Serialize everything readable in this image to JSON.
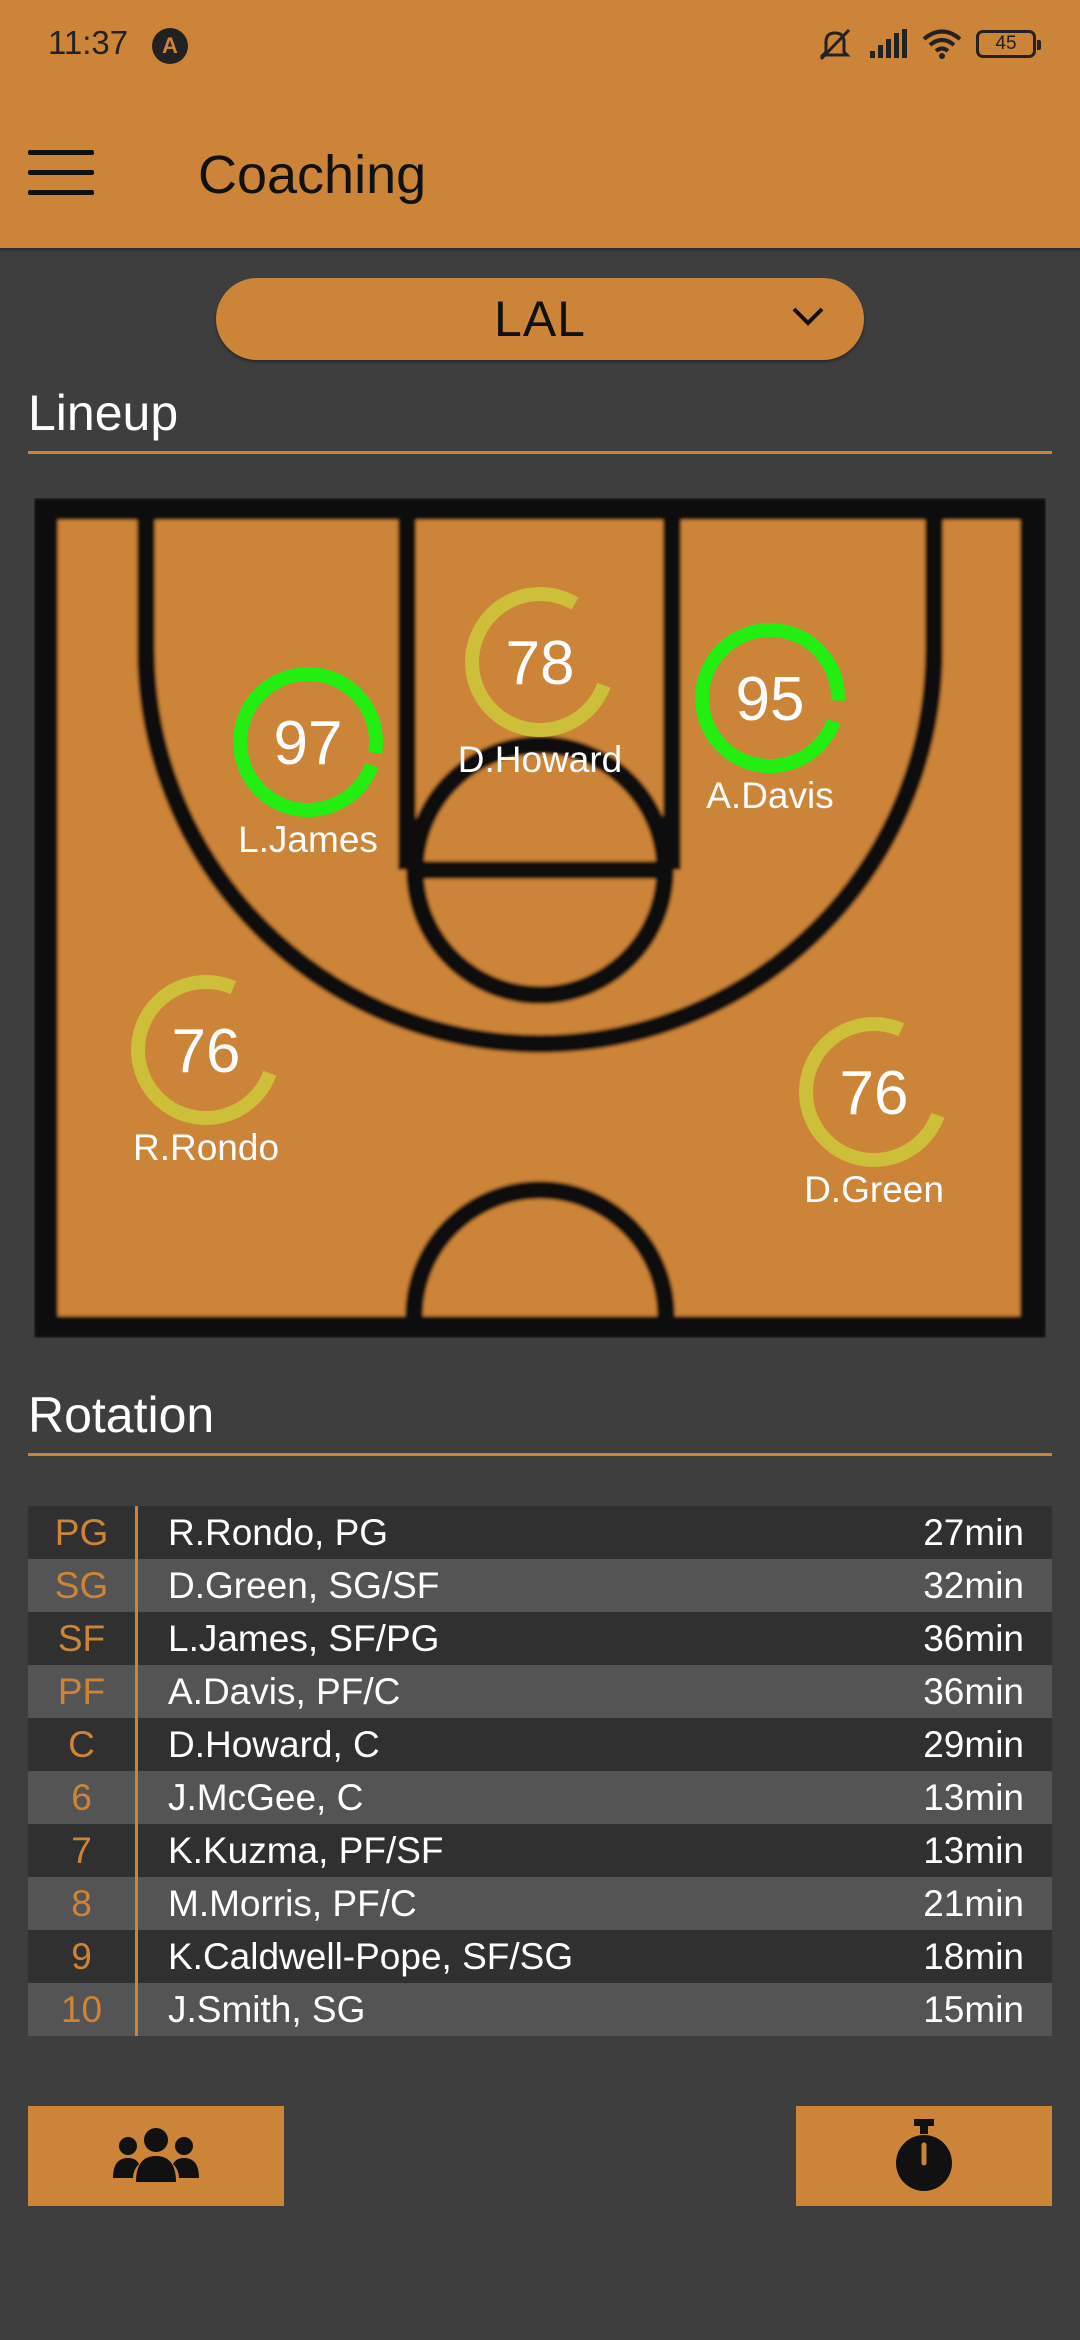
{
  "status_bar": {
    "time": "11:37",
    "app_icon_letter": "A",
    "battery": "45",
    "icons": [
      "mute-icon",
      "signal-icon",
      "wifi-icon",
      "battery-icon"
    ]
  },
  "app_bar": {
    "title": "Coaching",
    "menu_icon": "hamburger-menu-icon"
  },
  "team_selector": {
    "value": "LAL",
    "icon": "chevron-down-icon"
  },
  "lineup": {
    "title": "Lineup",
    "players": [
      {
        "name": "L.James",
        "rating": "97",
        "level": 97,
        "color": "#22ee11"
      },
      {
        "name": "D.Howard",
        "rating": "78",
        "level": 78,
        "color": "#cdbf3a"
      },
      {
        "name": "A.Davis",
        "rating": "95",
        "level": 95,
        "color": "#22ee11"
      },
      {
        "name": "R.Rondo",
        "rating": "76",
        "level": 76,
        "color": "#cdbf3a"
      },
      {
        "name": "D.Green",
        "rating": "76",
        "level": 76,
        "color": "#cdbf3a"
      }
    ]
  },
  "rotation": {
    "title": "Rotation",
    "rows": [
      {
        "slot": "PG",
        "player": "R.Rondo, PG",
        "minutes": "27min"
      },
      {
        "slot": "SG",
        "player": "D.Green, SG/SF",
        "minutes": "32min"
      },
      {
        "slot": "SF",
        "player": "L.James, SF/PG",
        "minutes": "36min"
      },
      {
        "slot": "PF",
        "player": "A.Davis, PF/C",
        "minutes": "36min"
      },
      {
        "slot": "C",
        "player": "D.Howard, C",
        "minutes": "29min"
      },
      {
        "slot": "6",
        "player": "J.McGee, C",
        "minutes": "13min"
      },
      {
        "slot": "7",
        "player": "K.Kuzma, PF/SF",
        "minutes": "13min"
      },
      {
        "slot": "8",
        "player": "M.Morris, PF/C",
        "minutes": "21min"
      },
      {
        "slot": "9",
        "player": "K.Caldwell-Pope, SF/SG",
        "minutes": "18min"
      },
      {
        "slot": "10",
        "player": "J.Smith, SG",
        "minutes": "15min"
      }
    ]
  },
  "bottom_bar": {
    "left_icon": "team-icon",
    "right_icon": "stopwatch-icon"
  },
  "colors": {
    "accent": "#cc8439",
    "background": "#3e3e3e",
    "good": "#22ee11",
    "average": "#cdbf3a"
  }
}
